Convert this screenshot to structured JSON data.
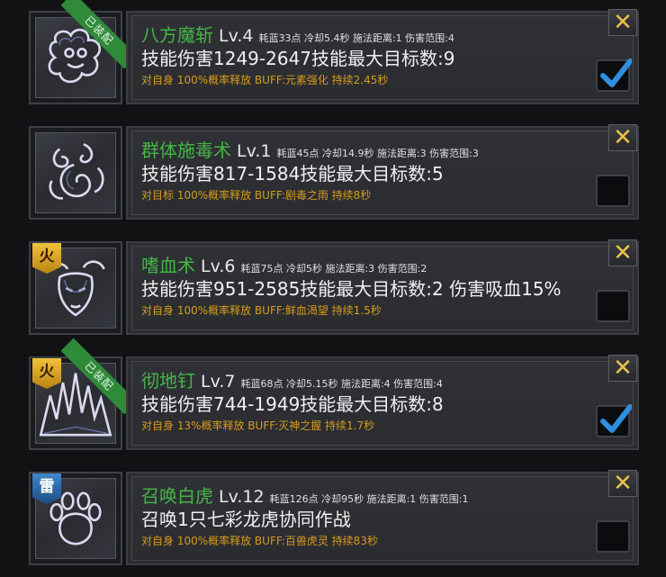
{
  "skills": [
    {
      "name": "八方魔斩",
      "level": "Lv.4",
      "meta": "耗蓝33点 冷却5.4秒 施法距离:1 伤害范围:4",
      "damage": "技能伤害1249-2647技能最大目标数:9",
      "buff": "对自身 100%概率释放 BUFF:元素强化 持续2.45秒",
      "equipped": true,
      "equipped_label": "已装配",
      "element": "",
      "checked": true,
      "icon": "beast-head-icon"
    },
    {
      "name": "群体施毒术",
      "level": "Lv.1",
      "meta": "耗蓝45点 冷却14.9秒 施法距离:3 伤害范围:3",
      "damage": "技能伤害817-1584技能最大目标数:5",
      "buff": "对目标 100%概率释放 BUFF:剧毒之雨 持续8秒",
      "equipped": false,
      "equipped_label": "",
      "element": "",
      "checked": false,
      "icon": "poison-swirl-icon"
    },
    {
      "name": "嗜血术",
      "level": "Lv.6",
      "meta": "耗蓝75点 冷却5秒 施法距离:3 伤害范围:2",
      "damage": "技能伤害951-2585技能最大目标数:2 伤害吸血15%",
      "buff": "对自身 100%概率释放 BUFF:鲜血渴望 持续1.5秒",
      "equipped": false,
      "equipped_label": "",
      "element": "火",
      "checked": false,
      "icon": "bull-head-icon"
    },
    {
      "name": "彻地钉",
      "level": "Lv.7",
      "meta": "耗蓝68点 冷却5.15秒 施法距离:4 伤害范围:4",
      "damage": "技能伤害744-1949技能最大目标数:8",
      "buff": "对自身 13%概率释放 BUFF:灭神之握 持续1.7秒",
      "equipped": true,
      "equipped_label": "已装配",
      "element": "火",
      "checked": true,
      "icon": "ground-spikes-icon"
    },
    {
      "name": "召唤白虎",
      "level": "Lv.12",
      "meta": "耗蓝126点 冷却95秒 施法距离:1 伤害范围:1",
      "damage": "召唤1只七彩龙虎协同作战",
      "buff": "对自身 100%概率释放 BUFF:百兽虎灵 持续83秒",
      "equipped": false,
      "equipped_label": "",
      "element": "雷",
      "checked": false,
      "icon": "paw-print-icon"
    }
  ],
  "close_symbol": "✕",
  "colors": {
    "name_green": "#46b646",
    "buff_orange": "#d89b1c",
    "ribbon_green": "#2f8a3a",
    "check_blue": "#2f8fe0",
    "close_gold": "#e8c14a"
  }
}
